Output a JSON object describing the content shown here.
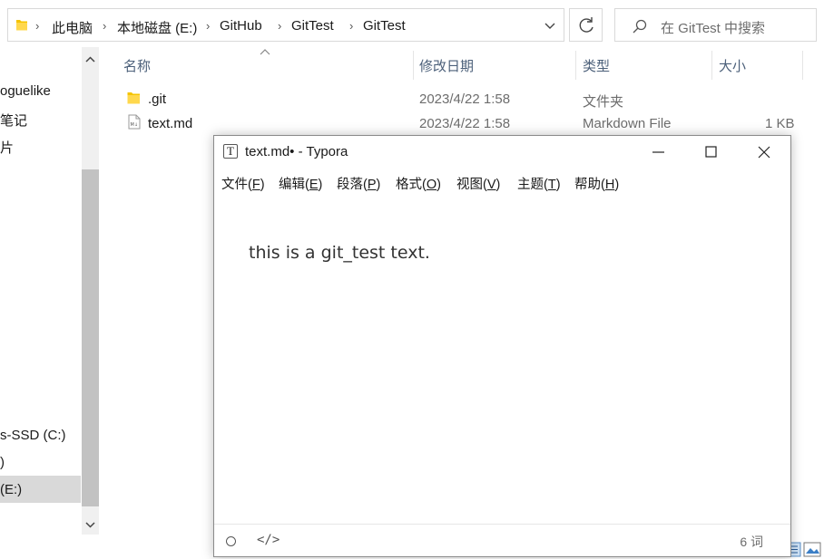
{
  "explorer": {
    "address": {
      "crumbs": [
        "此电脑",
        "本地磁盘 (E:)",
        "GitHub",
        "GitTest",
        "GitTest"
      ]
    },
    "search": {
      "placeholder": "在 GitTest 中搜索"
    },
    "nav": {
      "items": [
        "oguelike",
        "笔记",
        "片",
        "s-SSD (C:)",
        ")",
        " (E:)"
      ]
    },
    "columns": {
      "name": "名称",
      "modified": "修改日期",
      "type": "类型",
      "size": "大小"
    },
    "files": [
      {
        "name": ".git",
        "modified": "2023/4/22 1:58",
        "type": "文件夹",
        "size": "",
        "icon": "folder-icon"
      },
      {
        "name": "text.md",
        "modified": "2023/4/22 1:58",
        "type": "Markdown File",
        "size": "1 KB",
        "icon": "markdown-file-icon"
      }
    ]
  },
  "typora": {
    "title": "text.md• - Typora",
    "logo": "T",
    "menu": [
      {
        "label": "文件(",
        "key": "F",
        "end": ")"
      },
      {
        "label": "编辑(",
        "key": "E",
        "end": ")"
      },
      {
        "label": "段落(",
        "key": "P",
        "end": ")"
      },
      {
        "label": "格式(",
        "key": "O",
        "end": ")"
      },
      {
        "label": "视图(",
        "key": "V",
        "end": ")"
      },
      {
        "label": "主题(",
        "key": "T",
        "end": ")"
      },
      {
        "label": "帮助(",
        "key": "H",
        "end": ")"
      }
    ],
    "content": "this is a git_test text.",
    "status": {
      "code_label": "</>",
      "word_count": "6 词"
    }
  },
  "colors": {
    "header_text": "#4c607a",
    "folder_yellow": "#f5c400",
    "selection": "#d9d9d9"
  }
}
